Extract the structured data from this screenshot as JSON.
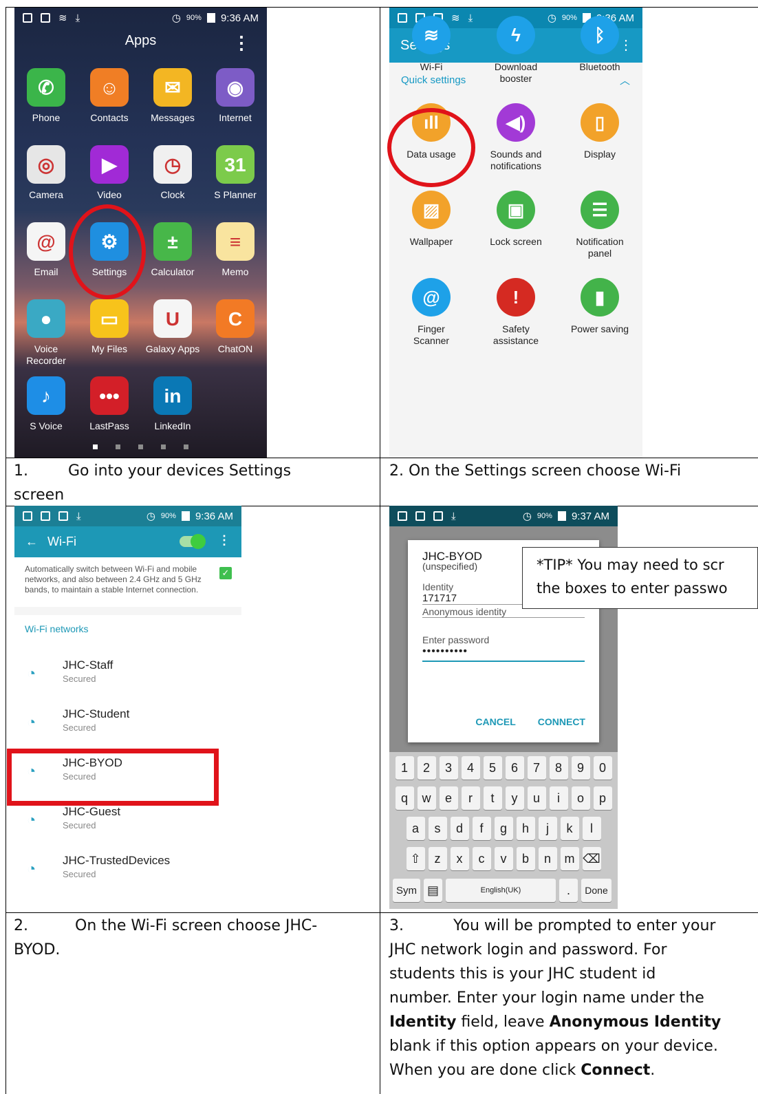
{
  "panel1": {
    "status_time": "9:36 AM",
    "status_battery": "90%",
    "title": "Apps",
    "apps": [
      {
        "label": "Phone",
        "color": "#3bb54a",
        "glyph": "✆"
      },
      {
        "label": "Contacts",
        "color": "#f07e25",
        "glyph": "☺"
      },
      {
        "label": "Messages",
        "color": "#f3b623",
        "glyph": "✉"
      },
      {
        "label": "Internet",
        "color": "#7d5cc6",
        "glyph": "◉"
      },
      {
        "label": "Camera",
        "color": "#e6e6e6",
        "glyph": "◎"
      },
      {
        "label": "Video",
        "color": "#a12ad6",
        "glyph": "▶"
      },
      {
        "label": "Clock",
        "color": "#f0f0f0",
        "glyph": "◷"
      },
      {
        "label": "S Planner",
        "color": "#7ccb4b",
        "glyph": "31"
      },
      {
        "label": "Email",
        "color": "#f5f5f5",
        "glyph": "@"
      },
      {
        "label": "Settings",
        "color": "#1f8fe0",
        "glyph": "⚙"
      },
      {
        "label": "Calculator",
        "color": "#47b749",
        "glyph": "±"
      },
      {
        "label": "Memo",
        "color": "#f9e49f",
        "glyph": "≡"
      },
      {
        "label": "Voice\nRecorder",
        "color": "#3aa9c4",
        "glyph": "●"
      },
      {
        "label": "My Files",
        "color": "#f7c31b",
        "glyph": "▭"
      },
      {
        "label": "Galaxy Apps",
        "color": "#f5f5f5",
        "glyph": "U"
      },
      {
        "label": "ChatON",
        "color": "#f27a25",
        "glyph": "C"
      },
      {
        "label": "S Voice",
        "color": "#1e8ee6",
        "glyph": "♪"
      },
      {
        "label": "LastPass",
        "color": "#d31f28",
        "glyph": "•••"
      },
      {
        "label": "LinkedIn",
        "color": "#0a78b5",
        "glyph": "in"
      }
    ]
  },
  "panel2": {
    "status_time": "9:36 AM",
    "status_battery": "90%",
    "title": "Settings",
    "section": "Quick settings",
    "items": [
      {
        "label": "Wi-Fi",
        "color": "#1ea1e8",
        "glyph": "≋"
      },
      {
        "label": "Download\nbooster",
        "color": "#1ea1e8",
        "glyph": "ϟ"
      },
      {
        "label": "Bluetooth",
        "color": "#1ea1e8",
        "glyph": "ᛒ"
      },
      {
        "label": "Data usage",
        "color": "#f2a22a",
        "glyph": "ıll"
      },
      {
        "label": "Sounds and\nnotifications",
        "color": "#a23ad6",
        "glyph": "◀)"
      },
      {
        "label": "Display",
        "color": "#f2a22a",
        "glyph": "▯"
      },
      {
        "label": "Wallpaper",
        "color": "#f2a22a",
        "glyph": "▨"
      },
      {
        "label": "Lock screen",
        "color": "#43b34a",
        "glyph": "▣"
      },
      {
        "label": "Notification\npanel",
        "color": "#43b34a",
        "glyph": "☰"
      },
      {
        "label": "Finger\nScanner",
        "color": "#1ea1e8",
        "glyph": "@"
      },
      {
        "label": "Safety\nassistance",
        "color": "#d52a22",
        "glyph": "!"
      },
      {
        "label": "Power saving",
        "color": "#43b34a",
        "glyph": "▮"
      }
    ]
  },
  "panel3": {
    "status_time": "9:36 AM",
    "status_battery": "90%",
    "title": "Wi-Fi",
    "note": "Automatically switch between Wi-Fi and mobile networks, and also between 2.4 GHz and 5 GHz bands, to maintain a stable Internet connection.",
    "section": "Wi-Fi networks",
    "networks": [
      {
        "name": "JHC-Staff",
        "status": "Secured"
      },
      {
        "name": "JHC-Student",
        "status": "Secured"
      },
      {
        "name": "JHC-BYOD",
        "status": "Secured"
      },
      {
        "name": "JHC-Guest",
        "status": "Secured"
      },
      {
        "name": "JHC-TrustedDevices",
        "status": "Secured"
      }
    ]
  },
  "panel4": {
    "status_time": "9:37 AM",
    "status_battery": "90%",
    "dialog_title": "JHC-BYOD",
    "dialog_sub": "(unspecified)",
    "identity_label": "Identity",
    "identity_value": "171717",
    "anon_label": "Anonymous identity",
    "password_label": "Enter password",
    "password_value": "••••••••••",
    "cancel": "CANCEL",
    "connect": "CONNECT",
    "keys_row1": [
      "1",
      "2",
      "3",
      "4",
      "5",
      "6",
      "7",
      "8",
      "9",
      "0"
    ],
    "keys_row2": [
      "q",
      "w",
      "e",
      "r",
      "t",
      "y",
      "u",
      "i",
      "o",
      "p"
    ],
    "keys_row3": [
      "a",
      "s",
      "d",
      "f",
      "g",
      "h",
      "j",
      "k",
      "l"
    ],
    "keys_row4": [
      "⇧",
      "z",
      "x",
      "c",
      "v",
      "b",
      "n",
      "m",
      "⌫"
    ],
    "key_sym": "Sym",
    "key_lang": "English(UK)",
    "key_done": "Done"
  },
  "tip": {
    "line1": "*TIP* You may need to scr",
    "line2": "the boxes to enter passwo"
  },
  "captions": {
    "c1_num": "1.",
    "c1_text": "Go into your devices Settings",
    "c1_cont": "screen",
    "c2": "2. On the Settings screen choose Wi-Fi",
    "c3_num": "2.",
    "c3_text": "On the Wi-Fi screen choose JHC-",
    "c3_cont": "BYOD.",
    "c4_num": "3.",
    "c4_text": "You will be prompted to enter your",
    "c4_l2": "JHC network login and password. For",
    "c4_l3": "students this is your JHC student id",
    "c4_l4": "number. Enter your login name under the",
    "c4_l5a": "Identity",
    "c4_l5b": " field, leave ",
    "c4_l5c": "Anonymous Identity",
    "c4_l6": "blank if this option appears on your device.",
    "c4_l7a": "When you are done click ",
    "c4_l7b": "Connect",
    "c4_l7c": "."
  }
}
